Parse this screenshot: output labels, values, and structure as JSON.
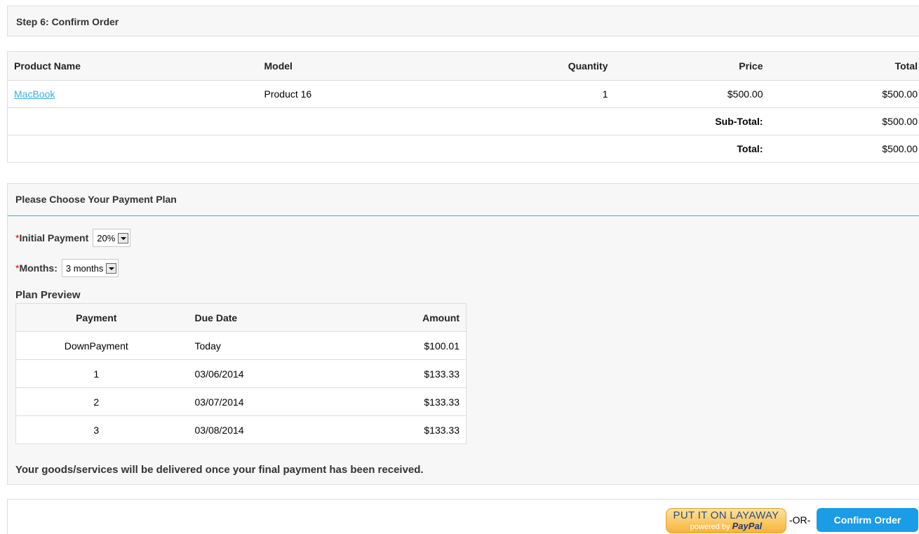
{
  "step": {
    "title": "Step 6: Confirm Order"
  },
  "order": {
    "headers": {
      "name": "Product Name",
      "model": "Model",
      "quantity": "Quantity",
      "price": "Price",
      "total": "Total"
    },
    "items": [
      {
        "name": "MacBook",
        "model": "Product 16",
        "quantity": "1",
        "price": "$500.00",
        "total": "$500.00"
      }
    ],
    "totals": [
      {
        "label": "Sub-Total:",
        "value": "$500.00"
      },
      {
        "label": "Total:",
        "value": "$500.00"
      }
    ]
  },
  "payment_plan": {
    "title": "Please Choose Your Payment Plan",
    "required_mark": "*",
    "initial_payment": {
      "label": "Initial Payment",
      "value": "20%"
    },
    "months": {
      "label": "Months:",
      "value": "3 months"
    },
    "preview": {
      "label": "Plan Preview",
      "headers": {
        "payment": "Payment",
        "due_date": "Due Date",
        "amount": "Amount"
      },
      "rows": [
        {
          "payment": "DownPayment",
          "due_date": "Today",
          "amount": "$100.01"
        },
        {
          "payment": "1",
          "due_date": "03/06/2014",
          "amount": "$133.33"
        },
        {
          "payment": "2",
          "due_date": "03/07/2014",
          "amount": "$133.33"
        },
        {
          "payment": "3",
          "due_date": "03/08/2014",
          "amount": "$133.33"
        }
      ]
    },
    "delivery_note": "Your goods/services will be delivered once your final payment has been received."
  },
  "actions": {
    "layaway_main": "PUT IT ON LAYAWAY",
    "layaway_powered": "powered by",
    "layaway_brand": "PayPal",
    "or_text": "-OR-",
    "confirm_label": "Confirm Order"
  },
  "colors": {
    "link": "#38b0e3",
    "confirm_button": "#1b9ce6",
    "required": "#e00000",
    "section_rule": "#38b0e3"
  }
}
